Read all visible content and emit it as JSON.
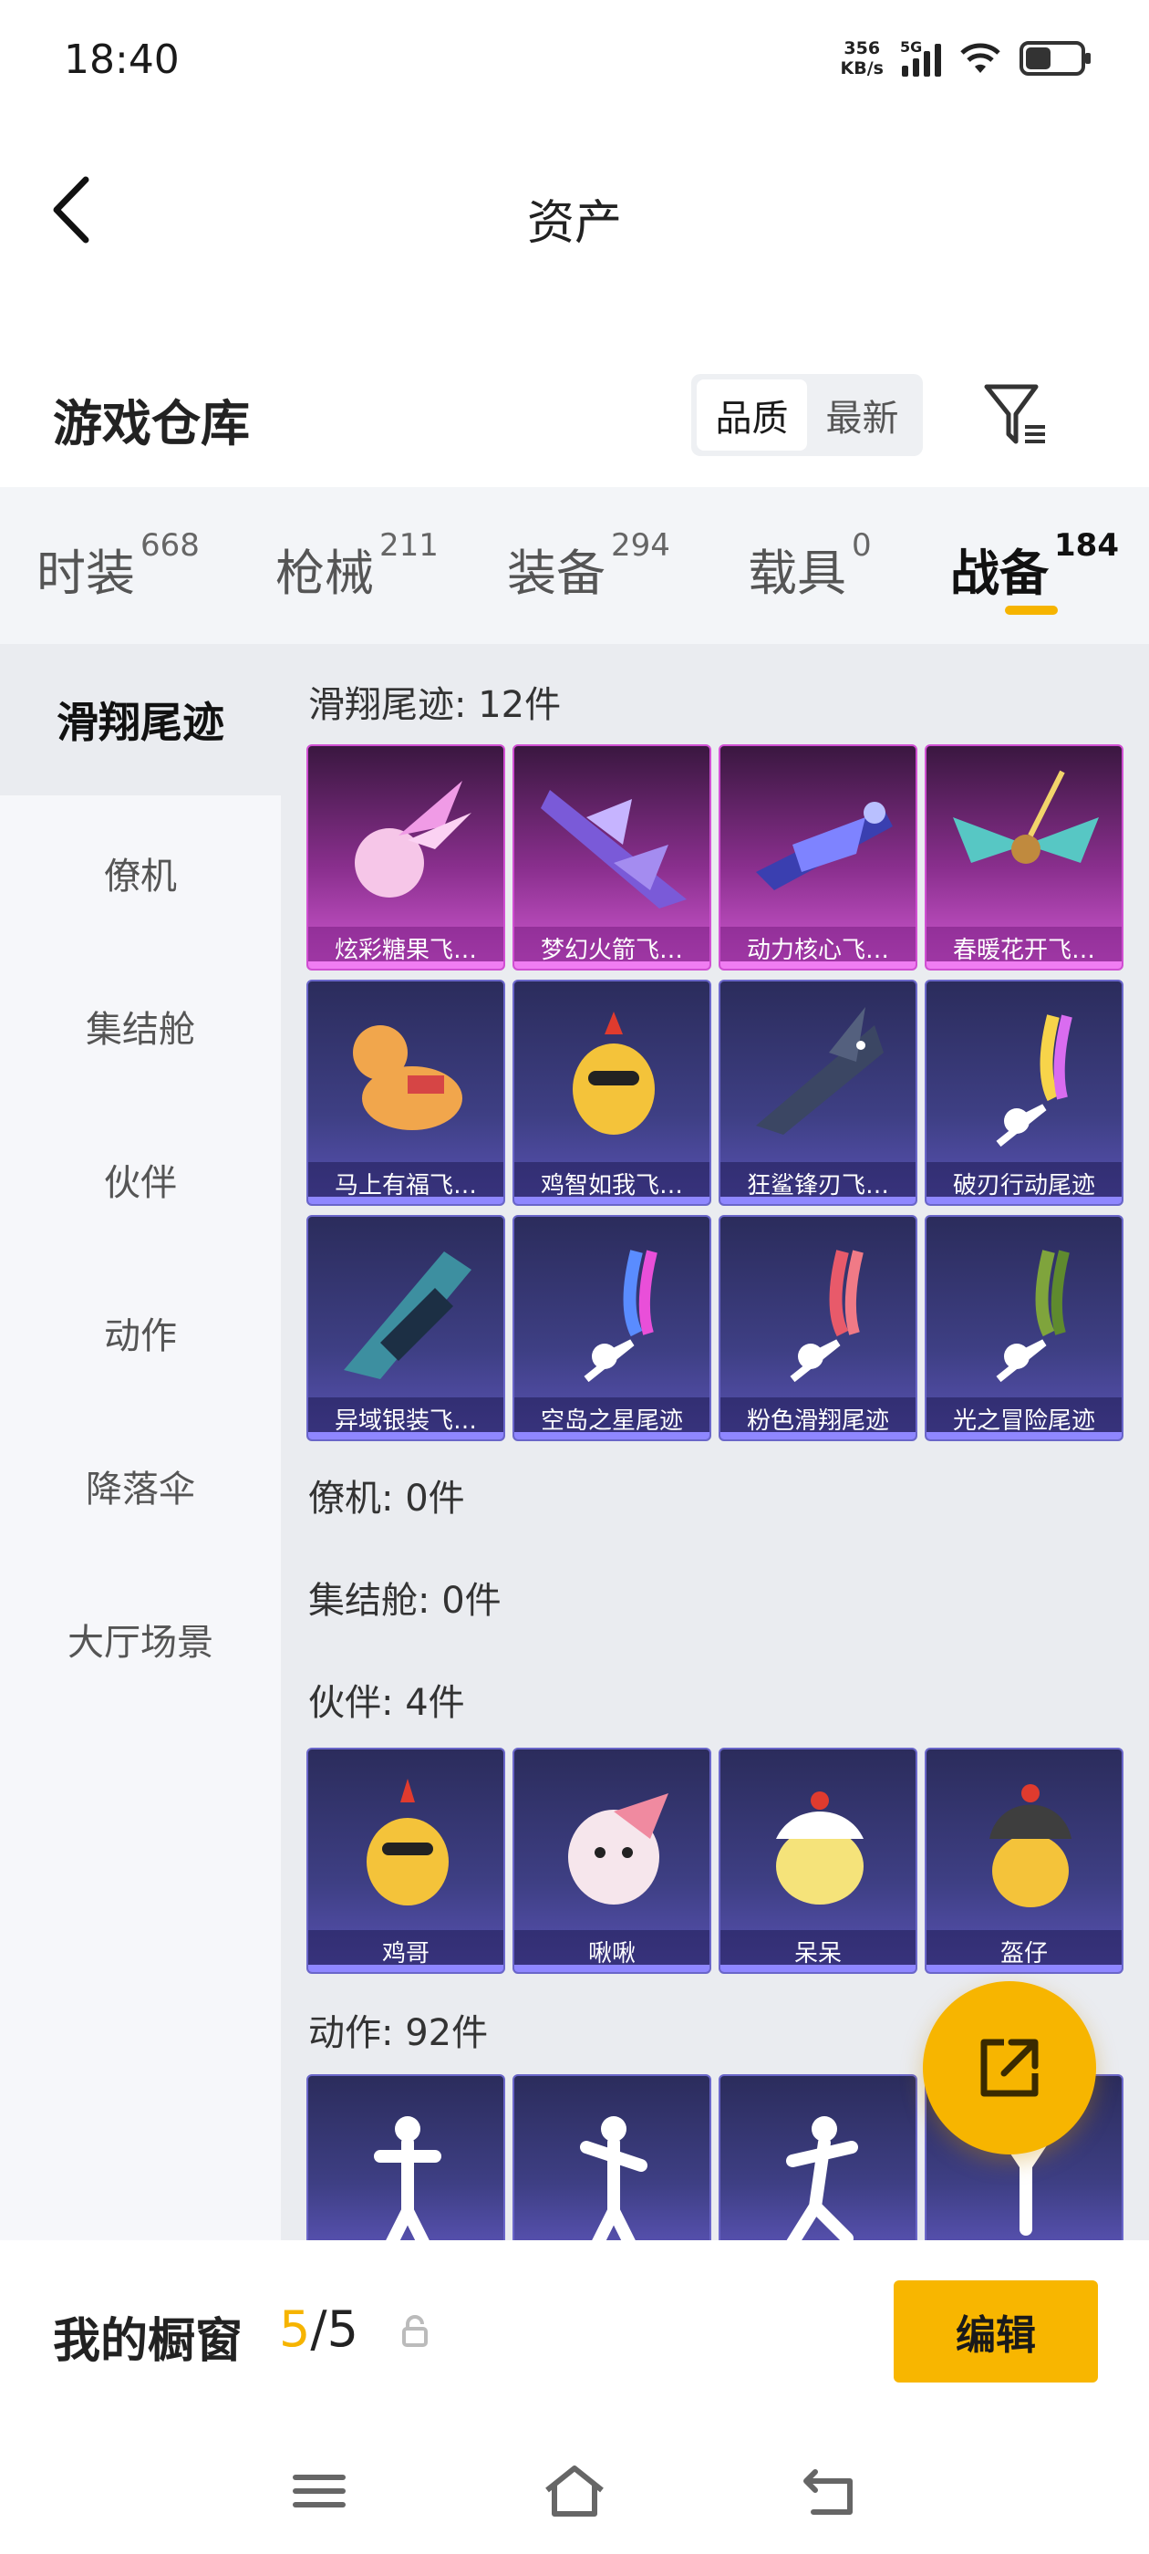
{
  "status_bar": {
    "time": "18:40",
    "net_speed_value": "356",
    "net_speed_unit": "KB/s",
    "network_type": "5G",
    "battery_level": 0.42
  },
  "header": {
    "title": "资产",
    "back_icon": "chevron-left-icon"
  },
  "warehouse": {
    "title": "游戏仓库",
    "sort_options": [
      {
        "label": "品质",
        "active": true
      },
      {
        "label": "最新",
        "active": false
      }
    ],
    "filter_icon": "filter-icon"
  },
  "tabs": [
    {
      "label": "时装",
      "count": "668",
      "active": false
    },
    {
      "label": "枪械",
      "count": "211",
      "active": false
    },
    {
      "label": "装备",
      "count": "294",
      "active": false
    },
    {
      "label": "载具",
      "count": "0",
      "active": false
    },
    {
      "label": "战备",
      "count": "184",
      "active": true
    }
  ],
  "sidebar": {
    "items": [
      {
        "label": "滑翔尾迹",
        "active": true
      },
      {
        "label": "僚机",
        "active": false
      },
      {
        "label": "集结舱",
        "active": false
      },
      {
        "label": "伙伴",
        "active": false
      },
      {
        "label": "动作",
        "active": false
      },
      {
        "label": "降落伞",
        "active": false
      },
      {
        "label": "大厅场景",
        "active": false
      }
    ]
  },
  "sections": {
    "glide_trail": {
      "title": "滑翔尾迹: 12件",
      "items": [
        {
          "label": "炫彩糖果飞…",
          "rarity": "legendary"
        },
        {
          "label": "梦幻火箭飞…",
          "rarity": "legendary"
        },
        {
          "label": "动力核心飞…",
          "rarity": "legendary"
        },
        {
          "label": "春暖花开飞…",
          "rarity": "legendary"
        },
        {
          "label": "马上有福飞…",
          "rarity": "epic"
        },
        {
          "label": "鸡智如我飞…",
          "rarity": "epic"
        },
        {
          "label": "狂鲨锋刃飞…",
          "rarity": "epic"
        },
        {
          "label": "破刃行动尾迹",
          "rarity": "epic"
        },
        {
          "label": "异域银装飞…",
          "rarity": "epic"
        },
        {
          "label": "空岛之星尾迹",
          "rarity": "epic"
        },
        {
          "label": "粉色滑翔尾迹",
          "rarity": "epic"
        },
        {
          "label": "光之冒险尾迹",
          "rarity": "epic"
        }
      ]
    },
    "wingman": {
      "title": "僚机: 0件"
    },
    "capsule": {
      "title": "集结舱: 0件"
    },
    "companion": {
      "title": "伙伴: 4件",
      "items": [
        {
          "label": "鸡哥"
        },
        {
          "label": "啾啾"
        },
        {
          "label": "呆呆"
        },
        {
          "label": "盔仔"
        }
      ]
    },
    "emote": {
      "title": "动作: 92件"
    }
  },
  "showcase": {
    "title": "我的橱窗",
    "current": "5",
    "separator": "/",
    "total": "5",
    "edit_label": "编辑"
  },
  "colors": {
    "accent": "#f6b400",
    "legendary": "#d04fd2",
    "epic": "#6a66c9"
  }
}
